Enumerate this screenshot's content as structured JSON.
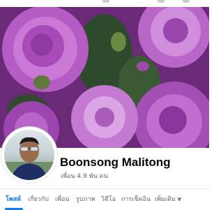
{
  "profile": {
    "name": "Boonsong Malitong",
    "friends_count": "เพื่อน 4.9 พัน คน"
  },
  "tabs": [
    {
      "label": "โพสต์",
      "active": true
    },
    {
      "label": "เกี่ยวกับ"
    },
    {
      "label": "เพื่อน"
    },
    {
      "label": "รูปภาพ"
    },
    {
      "label": "วิดีโอ"
    },
    {
      "label": "การเช็คอิน"
    },
    {
      "label": "เพิ่มเติม"
    }
  ],
  "colors": {
    "accent": "#1877f2",
    "cover_primary": "#9a3fae",
    "cover_light": "#d79be0"
  },
  "icons": {
    "more_tab": "caret-down-icon"
  }
}
